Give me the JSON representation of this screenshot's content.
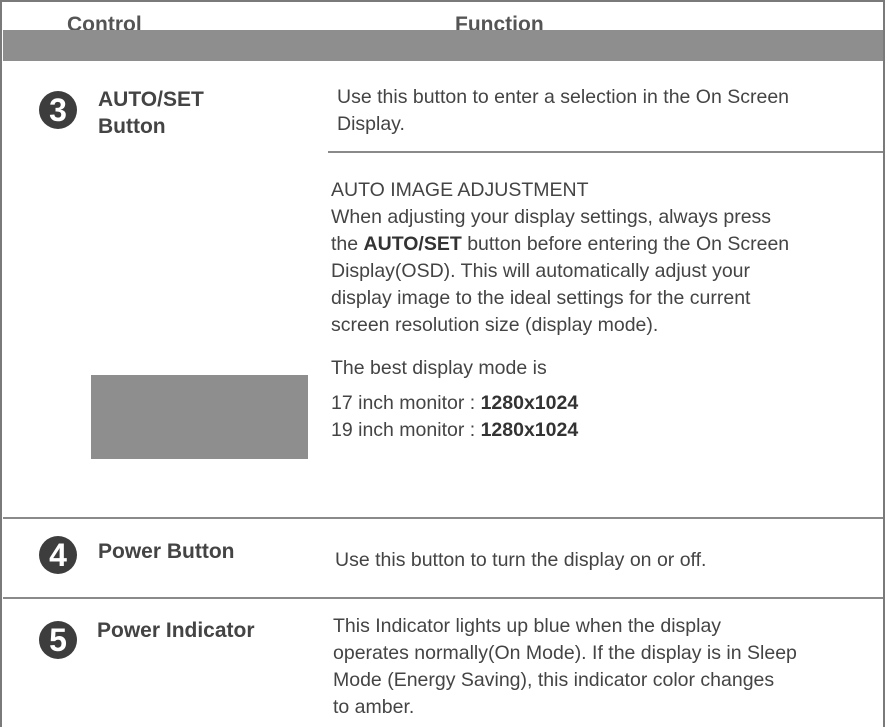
{
  "header": {
    "control": "Control",
    "function": "Function"
  },
  "rows": [
    {
      "number": "3",
      "label_line1": "AUTO/SET",
      "label_line2": "Button",
      "function_line1": "Use this button to enter a selection in the On Screen",
      "function_line2": "Display.",
      "sub_heading": "AUTO IMAGE ADJUSTMENT",
      "sub_lines": [
        "When adjusting your display settings, always press",
        "the",
        "AUTO/SET",
        "button before entering the On Screen",
        "Display(OSD). This will automatically adjust your",
        "display image to the ideal settings for the current",
        "screen resolution size (display mode)."
      ],
      "best_mode_label": "The best display mode is",
      "modes": [
        {
          "label": "17 inch monitor : ",
          "value": "1280x1024"
        },
        {
          "label": "19 inch monitor : ",
          "value": "1280x1024"
        }
      ]
    },
    {
      "number": "4",
      "label": "Power Button",
      "function": "Use this button to turn the display on or off."
    },
    {
      "number": "5",
      "label": "Power Indicator",
      "function_lines": [
        "This Indicator lights up blue when the display",
        "operates normally(On Mode). If the display is in Sleep",
        "Mode (Energy Saving), this indicator color changes",
        "to amber."
      ]
    }
  ]
}
